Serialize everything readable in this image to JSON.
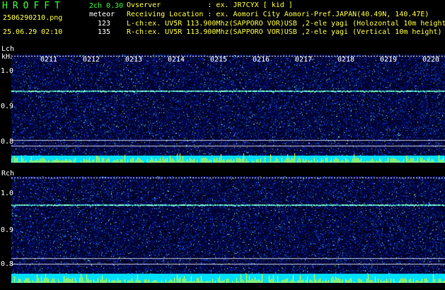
{
  "app": {
    "title": "HROFFT",
    "version": "2ch 0.30"
  },
  "file": {
    "name": "2506290210.png",
    "datetime": "25.06.29 02:10"
  },
  "meteor": {
    "label": "meteor",
    "count_l": "123",
    "count_r": "135"
  },
  "info": {
    "observer": "Ovserver           : ex. JR7CYX [ kid ]",
    "location": "Receiving Location : ex. Aomori City Aomori-Pref.JAPAN(40.49N, 140.47E)",
    "lch": "L-ch:ex. UV5R 113.900Mhz(SAPPORO VOR)USB ,2-ele yagi (Holozontal 10m height)",
    "rch": "R-ch:ex. UV5R 113.900Mhz(SAPPORO VOR)USB ,2-ele yagi (Vertical 10m height)"
  },
  "channels": {
    "lch": {
      "label": "Lch",
      "unit": "kHz",
      "yticks": [
        "1.0",
        "0.9",
        "0.8"
      ],
      "times": [
        "0211",
        "0212",
        "0213",
        "0214",
        "0215",
        "0216",
        "0217",
        "0218",
        "0219",
        "0220"
      ]
    },
    "rch": {
      "label": "Rch",
      "yticks": [
        "1.0",
        "0.9",
        "0.8"
      ]
    }
  },
  "colors": {
    "background": "#000000",
    "spectrogram_dark": "#00002a",
    "spectrogram_blue": "#1a2fd0",
    "signal_line": "#7fffd4",
    "bar_yellow": "#ffff00",
    "bar_cyan": "#00e0ff",
    "title_green": "#39ff39",
    "text_yellow": "#ffff3c"
  }
}
